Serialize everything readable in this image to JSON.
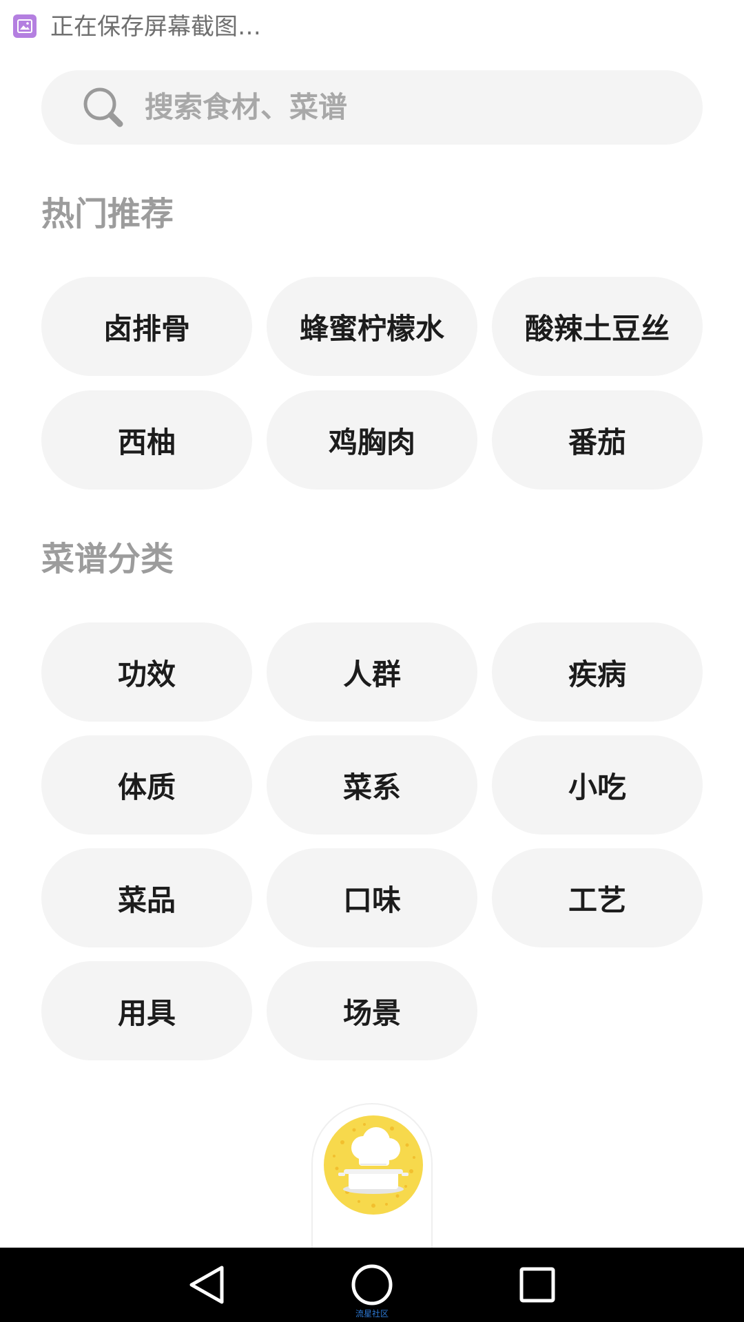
{
  "status": {
    "icon": "screenshot-icon",
    "message": "正在保存屏幕截图…"
  },
  "search": {
    "icon": "search-icon",
    "placeholder": "搜索食材、菜谱"
  },
  "hot": {
    "title": "热门推荐",
    "items": [
      "卤排骨",
      "蜂蜜柠檬水",
      "酸辣土豆丝",
      "西柚",
      "鸡胸肉",
      "番茄"
    ]
  },
  "categories": {
    "title": "菜谱分类",
    "items": [
      "功效",
      "人群",
      "疾病",
      "体质",
      "菜系",
      "小吃",
      "菜品",
      "口味",
      "工艺",
      "用具",
      "场景"
    ]
  },
  "logo": {
    "icon": "chef-hat-pot-logo",
    "accent": "#f7d94c"
  },
  "nav": {
    "back_icon": "back-triangle-icon",
    "home_icon": "home-circle-icon",
    "recent_icon": "recent-square-icon",
    "caption": "流星社区"
  },
  "colors": {
    "chip_bg": "#f4f4f4",
    "section_title": "#9c9c9c",
    "chip_text": "#1c1c1c",
    "status_icon": "#b47fe0"
  }
}
